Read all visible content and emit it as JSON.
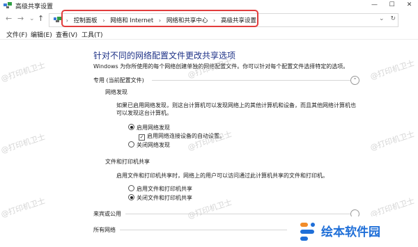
{
  "window": {
    "title": "高级共享设置",
    "min_label": "—",
    "max_label": "☐",
    "close_label": "✕"
  },
  "nav": {
    "back": "←",
    "forward": "→",
    "history": "⌄",
    "up": "↑"
  },
  "address": {
    "crumbs": [
      "控制面板",
      "网络和 Internet",
      "网络和共享中心",
      "高级共享设置"
    ],
    "separator": "›",
    "dropdown": "⌄",
    "refresh": "↻"
  },
  "menu": [
    "文件(F)",
    "编辑(E)",
    "查看(V)",
    "工具(T)"
  ],
  "page": {
    "heading": "针对不同的网络配置文件更改共享选项",
    "description": "Windows 为你所使用的每个网络创建单独的网络配置文件。你可以针对每个配置文件选择特定的选项。"
  },
  "sections": {
    "private": {
      "title": "专用 (当前配置文件)",
      "collapse": "⌃",
      "discovery": {
        "heading": "网络发现",
        "text": "如果已启用网络发现，则这台计算机可以发现网络上的其他计算机和设备，而且其他网络计算机也可以发现这台计算机。",
        "on_label": "启用网络发现",
        "auto_label": "启用网络连接设备的自动设置。",
        "off_label": "关闭网络发现",
        "selected": "on",
        "auto_checked": true
      },
      "sharing": {
        "heading": "文件和打印机共享",
        "text": "启用文件和打印机共享时，网络上的用户可以访问通过此计算机共享的文件和打印机。",
        "on_label": "启用文件和打印机共享",
        "off_label": "关闭文件和打印机共享",
        "selected": "off"
      }
    },
    "guest": {
      "title": "来宾或公用"
    },
    "all": {
      "title": "所有网络"
    }
  },
  "watermarks": [
    "@打印机卫士",
    "@打印机卫士",
    "@打印机卫士",
    "@打印机卫士",
    "@打印机卫士",
    "@打印机卫士",
    "@打印机卫士",
    "@打印机卫士",
    "@打印机卫士"
  ],
  "logo": {
    "text": "绘本软件园"
  },
  "colors": {
    "heading": "#1e3287",
    "highlight": "#e23c3c",
    "logo": "#1f6fd8"
  }
}
